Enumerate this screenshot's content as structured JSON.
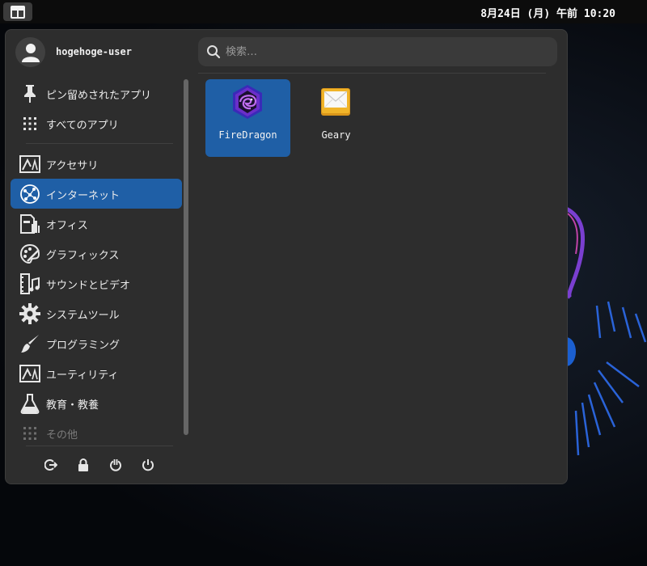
{
  "panel": {
    "clock": "8月24日 (月) 午前 10:20",
    "menu_icon": "applications-menu-icon"
  },
  "menu": {
    "user": {
      "name": "hogehoge-user",
      "icon": "user-avatar-icon"
    },
    "search": {
      "placeholder": "検索…",
      "value": "",
      "icon": "search-icon"
    },
    "pinned": [
      {
        "label": "ピン留めされたアプリ",
        "icon": "pin-icon"
      },
      {
        "label": "すべてのアプリ",
        "icon": "app-grid-icon"
      }
    ],
    "categories": [
      {
        "label": "アクセサリ",
        "icon": "accessories-icon",
        "active": false
      },
      {
        "label": "インターネット",
        "icon": "internet-globe-icon",
        "active": true
      },
      {
        "label": "オフィス",
        "icon": "office-icon",
        "active": false
      },
      {
        "label": "グラフィックス",
        "icon": "palette-icon",
        "active": false
      },
      {
        "label": "サウンドとビデオ",
        "icon": "film-music-icon",
        "active": false
      },
      {
        "label": "システムツール",
        "icon": "gear-icon",
        "active": false
      },
      {
        "label": "プログラミング",
        "icon": "brush-icon",
        "active": false
      },
      {
        "label": "ユーティリティ",
        "icon": "utilities-icon",
        "active": false
      },
      {
        "label": "教育・教養",
        "icon": "flask-icon",
        "active": false
      },
      {
        "label": "その他",
        "icon": "app-grid-icon",
        "active": false
      }
    ],
    "actions": [
      {
        "name": "logout",
        "icon": "logout-icon"
      },
      {
        "name": "lock",
        "icon": "lock-icon"
      },
      {
        "name": "suspend",
        "icon": "suspend-icon"
      },
      {
        "name": "power",
        "icon": "power-icon"
      }
    ],
    "apps": [
      {
        "label": "FireDragon",
        "icon": "firedragon-icon",
        "selected": true
      },
      {
        "label": "Geary",
        "icon": "geary-mail-icon",
        "selected": false
      }
    ]
  },
  "colors": {
    "accent": "#1f5fa6",
    "menu_bg": "#2d2d2d",
    "panel_bg": "#0c0c0c",
    "firedragon": "#6b2ec9",
    "geary": "#f0b429"
  }
}
